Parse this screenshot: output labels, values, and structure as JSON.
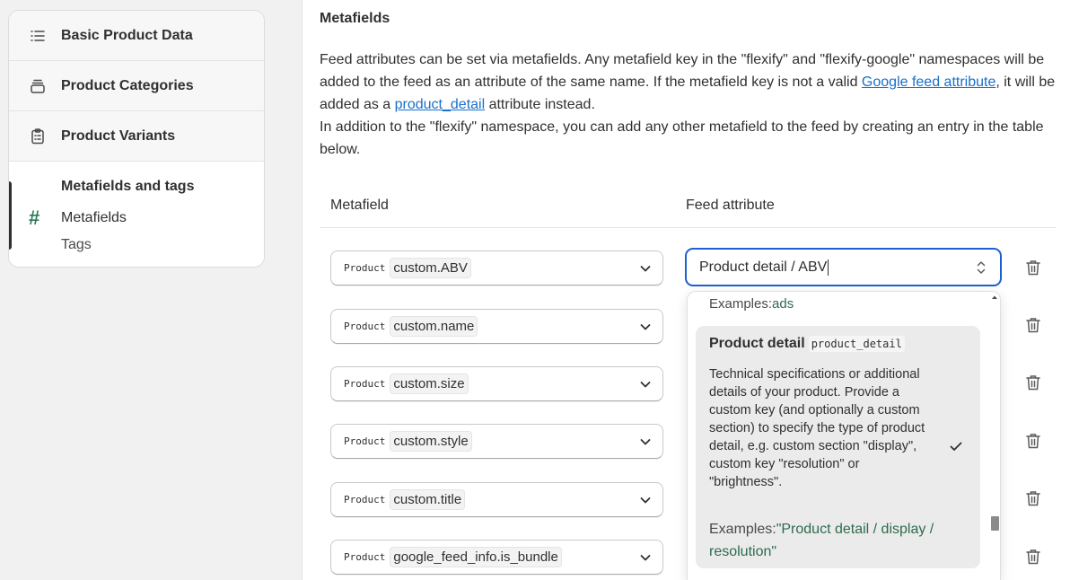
{
  "sidebar": {
    "items": [
      {
        "label": "Basic Product Data",
        "icon": "list-icon"
      },
      {
        "label": "Product Categories",
        "icon": "stack-icon"
      },
      {
        "label": "Product Variants",
        "icon": "clipboard-icon"
      }
    ],
    "active": {
      "title": "Metafields and tags",
      "icon": "hash-icon",
      "icon_glyph": "#",
      "sub_items": [
        "Metafields",
        "Tags"
      ]
    }
  },
  "main": {
    "section_title": "Metafields",
    "description": {
      "p1_a": "Feed attributes can be set via metafields. Any metafield key in the \"flexify\" and \"flexify-google\" namespaces will be added to the feed as an attribute of the same name. If the metafield key is not a valid ",
      "link1": "Google feed attribute",
      "p1_b": ", it will be added as a ",
      "link2": "product_detail",
      "p1_c": " attribute instead.",
      "p2": "In addition to the \"flexify\" namespace, you can add any other metafield to the feed by creating an entry in the table below."
    },
    "table": {
      "headers": {
        "metafield": "Metafield",
        "feed_attribute": "Feed attribute"
      },
      "rows": [
        {
          "owner": "Product",
          "key": "custom.ABV"
        },
        {
          "owner": "Product",
          "key": "custom.name"
        },
        {
          "owner": "Product",
          "key": "custom.size"
        },
        {
          "owner": "Product",
          "key": "custom.style"
        },
        {
          "owner": "Product",
          "key": "custom.title"
        },
        {
          "owner": "Product",
          "key": "google_feed_info.is_bundle"
        }
      ]
    },
    "combobox": {
      "value": "Product detail / ABV"
    },
    "dropdown": {
      "prev_examples_label": "Examples:",
      "prev_examples_value": "ads",
      "option": {
        "title": "Product detail",
        "code": "product_detail",
        "description": "Technical specifications or additional details of your product. Provide a custom key (and optionally a custom section) to specify the type of product detail, e.g. custom section \"display\", custom key \"resolution\" or \"brightness\".",
        "examples_label": "Examples:",
        "examples_value": "\"Product detail / display / resolution\"",
        "selected": true
      }
    }
  },
  "colors": {
    "accent": "#1f5fcf",
    "link": "#1a6fc9",
    "example_value": "#2e6b4f",
    "active_bar": "#303030"
  }
}
